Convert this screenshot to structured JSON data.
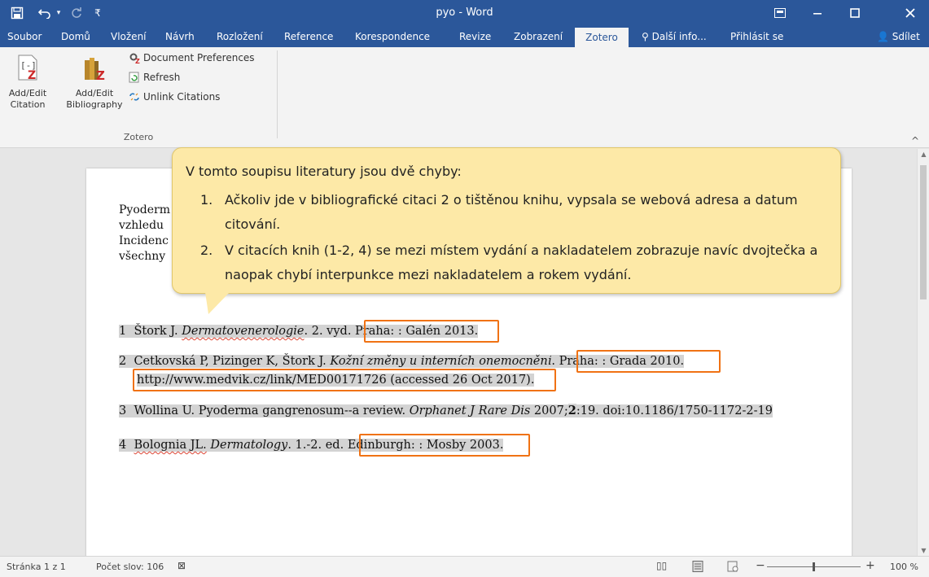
{
  "titlebar": {
    "title": "pyo - Word",
    "save_icon": "save-icon",
    "undo_icon": "undo-icon",
    "redo_icon": "redo-icon",
    "customize_icon": "customize-qat-icon",
    "ribbon_display_icon": "ribbon-display-options-icon",
    "minimize_icon": "minimize-icon",
    "maximize_icon": "maximize-icon",
    "close_icon": "close-icon"
  },
  "tabs": [
    {
      "label": "Soubor"
    },
    {
      "label": "Domů"
    },
    {
      "label": "Vložení"
    },
    {
      "label": "Návrh"
    },
    {
      "label": "Rozložení"
    },
    {
      "label": "Reference"
    },
    {
      "label": "Korespondence"
    },
    {
      "label": "Revize"
    },
    {
      "label": "Zobrazení"
    },
    {
      "label": "Zotero"
    }
  ],
  "tabs_right": {
    "tell_me": "Další info...",
    "sign_in": "Přihlásit se",
    "share": "Sdílet"
  },
  "ribbon": {
    "add_edit_citation": "Add/Edit\nCitation",
    "add_edit_citation_l1": "Add/Edit",
    "add_edit_citation_l2": "Citation",
    "add_edit_bibliography_l1": "Add/Edit",
    "add_edit_bibliography_l2": "Bibliography",
    "document_preferences": "Document Preferences",
    "refresh": "Refresh",
    "unlink_citations": "Unlink Citations",
    "group_label": "Zotero"
  },
  "document": {
    "para_lines": [
      "Pyoderm",
      "vzhledu",
      "Incidenc",
      "všechny"
    ],
    "references": [
      {
        "num": "1",
        "author": "Štork J.",
        "title": "Dermatovenerologie",
        "rest": ". 2. vyd.",
        "place_pub": "Praha: : Galén 2013."
      },
      {
        "num": "2",
        "author": "Cetkovská P, Pizinger K, Štork J.",
        "title": "Kožní změny u interních onemocnění",
        "rest": ".",
        "place_pub": "Praha: : Grada 2010.",
        "url_line": "http://www.medvik.cz/link/MED00171726 (accessed 26 Oct 2017)."
      },
      {
        "num": "3",
        "text_a": "Wollina U. Pyoderma gangrenosum--a review. ",
        "journal": "Orphanet J Rare Dis",
        "text_b": " 2007;",
        "volume": "2",
        "text_c": ":19. doi:10.1186/1750-1172-2-19"
      },
      {
        "num": "4",
        "author": "Bolognia JL.",
        "title": "Dermatology",
        "rest": ". 1.-2. ed.",
        "place_pub": "Edinburgh: : Mosby 2003."
      }
    ]
  },
  "callout": {
    "intro": "V tomto soupisu literatury jsou dvě chyby:",
    "items": [
      {
        "num": "1.",
        "text": "Ačkoliv jde v bibliografické citaci 2 o tištěnou knihu, vypsala se webová adresa a datum citování."
      },
      {
        "num": "2.",
        "text": "V citacích knih (1-2, 4) se mezi místem vydání a nakladatelem zobrazuje navíc dvojtečka a naopak chybí interpunkce mezi nakladatelem a rokem vydání."
      }
    ]
  },
  "status": {
    "page": "Stránka 1 z 1",
    "words": "Počet slov: 106",
    "zoom": "100 %"
  },
  "colors": {
    "word_blue": "#2b579a",
    "callout_bg": "#fde9a7",
    "highlight_box": "#f07214",
    "field_shading": "#d3d3d3"
  }
}
